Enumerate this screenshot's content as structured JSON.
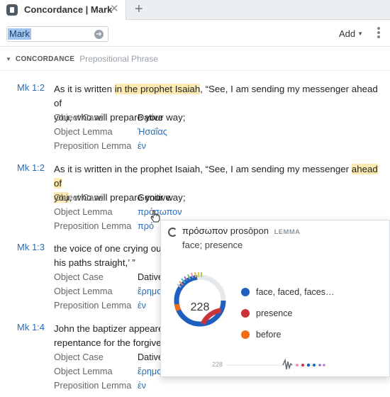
{
  "tab": {
    "title": "Concordance | Mark",
    "close_glyph": "✕",
    "add_glyph": "+"
  },
  "toolbar": {
    "search_value": "Mark",
    "go_glyph": "➔",
    "add_label": "Add",
    "add_caret": "▼"
  },
  "section": {
    "caret": "▼",
    "title": "CONCORDANCE",
    "subtitle": "Prepositional Phrase"
  },
  "meta_labels": {
    "object_case": "Object Case",
    "object_lemma": "Object Lemma",
    "preposition_lemma": "Preposition Lemma"
  },
  "results": [
    {
      "ref": "Mk 1:2",
      "line1_before": "As it is written ",
      "line1_highlight": "in the prophet Isaiah",
      "line1_after": ", “See, I am sending my messenger ahead of",
      "line2_highlight": "",
      "line2_after": "you, who will prepare your way;",
      "object_case": "Dative",
      "object_lemma": "Ἠσαΐας",
      "preposition_lemma": "ἐν"
    },
    {
      "ref": "Mk 1:2",
      "line1_before": "As it is written in the prophet Isaiah, “See, I am sending my messenger ",
      "line1_highlight": "ahead of",
      "line1_after": "",
      "line2_highlight": "you",
      "line2_after": ", who will prepare your way;",
      "object_case": "Genitive",
      "object_lemma": "πρόσωπον",
      "preposition_lemma": "πρό"
    },
    {
      "ref": "Mk 1:3",
      "line1_before": "the voice of one crying out",
      "line1_highlight": "",
      "line1_after": "",
      "line2_highlight": "",
      "line2_after": "his paths straight,’ ”",
      "object_case": "Dative",
      "object_lemma": "ἔρημο",
      "preposition_lemma": "ἐν"
    },
    {
      "ref": "Mk 1:4",
      "line1_before": "John the baptizer appeared",
      "line1_highlight": "",
      "line1_after": "",
      "line2_highlight": "",
      "line2_after": "repentance for the forgiven",
      "object_case": "Dative",
      "object_lemma": "ἔρημο",
      "preposition_lemma": "ἐν"
    }
  ],
  "popover": {
    "lemma": "πρόσωπον",
    "transliteration": "prosōpon",
    "badge": "LEMMA",
    "gloss": "face; presence",
    "total": "228",
    "legend": [
      {
        "label": "face, faced, faces…",
        "color": "#1f5fbf"
      },
      {
        "label": "presence",
        "color": "#c9343a"
      },
      {
        "label": "before",
        "color": "#ef6c14"
      }
    ],
    "sparkline_count": "228"
  }
}
